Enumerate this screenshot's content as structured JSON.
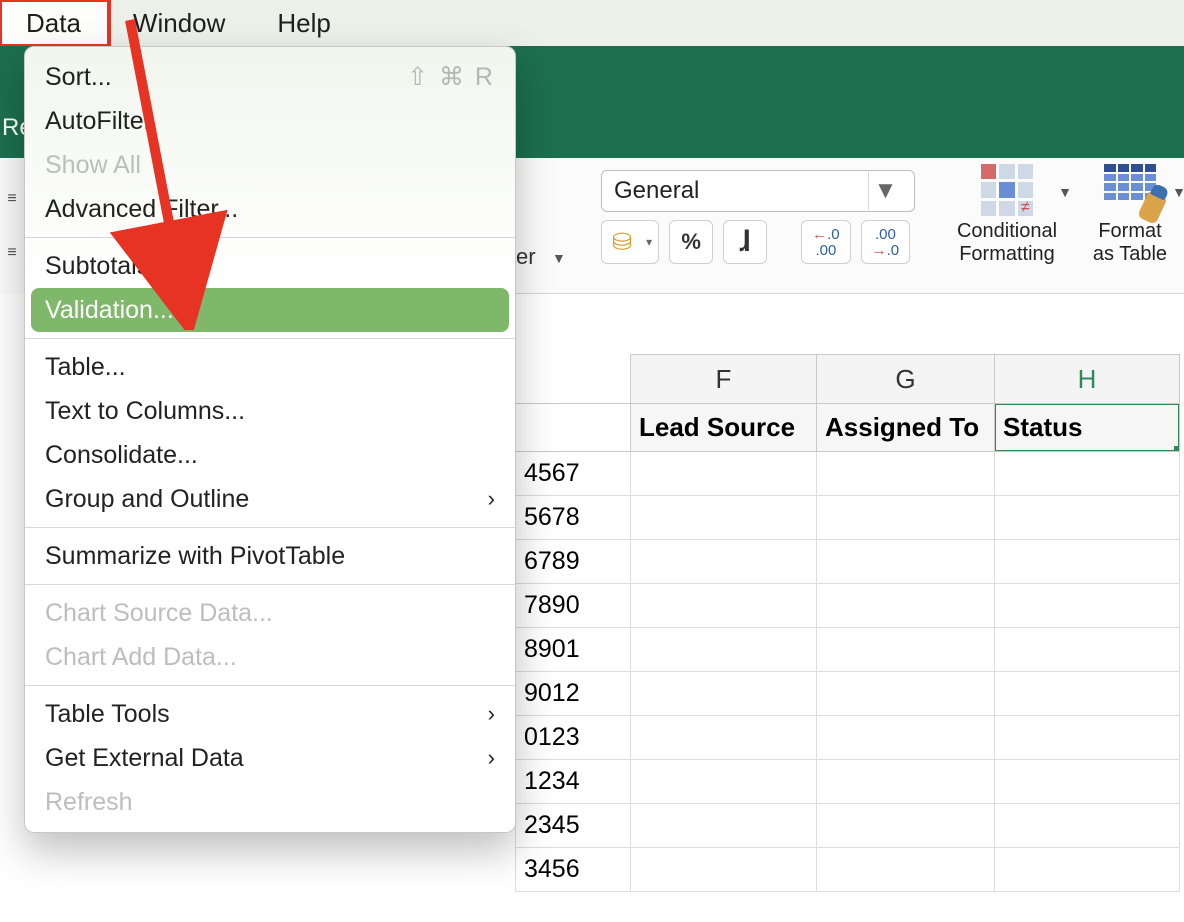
{
  "menubar": {
    "items": [
      "Data",
      "Window",
      "Help"
    ],
    "active_index": 0
  },
  "dropdown": {
    "groups": [
      [
        {
          "label": "Sort...",
          "shortcut": "⇧ ⌘ R"
        },
        {
          "label": "AutoFilter"
        },
        {
          "label": "Show All",
          "disabled": true
        },
        {
          "label": "Advanced Filter..."
        }
      ],
      [
        {
          "label": "Subtotals..."
        },
        {
          "label": "Validation...",
          "selected": true
        }
      ],
      [
        {
          "label": "Table..."
        },
        {
          "label": "Text to Columns..."
        },
        {
          "label": "Consolidate..."
        },
        {
          "label": "Group and Outline",
          "submenu": true
        }
      ],
      [
        {
          "label": "Summarize with PivotTable"
        }
      ],
      [
        {
          "label": "Chart Source Data...",
          "disabled": true
        },
        {
          "label": "Chart Add Data...",
          "disabled": true
        }
      ],
      [
        {
          "label": "Table Tools",
          "submenu": true
        },
        {
          "label": "Get External Data",
          "submenu": true
        },
        {
          "label": "Refresh",
          "disabled": true
        }
      ]
    ]
  },
  "ribbon": {
    "partial_left_text": "Re",
    "truncated_group_label_suffix": "er",
    "number_format": "General",
    "style_group": {
      "conditional_formatting": {
        "line1": "Conditional",
        "line2": "Formatting"
      },
      "format_as_table": {
        "line1": "Format",
        "line2": "as Table"
      }
    }
  },
  "sheet": {
    "visible_column_letters": {
      "f": "F",
      "g": "G",
      "h": "H"
    },
    "header_row": {
      "f": "Lead Source",
      "g": "Assigned To",
      "h": "Status"
    },
    "selected_cell": "H1",
    "e_column_partial_values": [
      "4567",
      "5678",
      "6789",
      "7890",
      "8901",
      "9012",
      "0123",
      "1234",
      "2345",
      "3456"
    ]
  }
}
